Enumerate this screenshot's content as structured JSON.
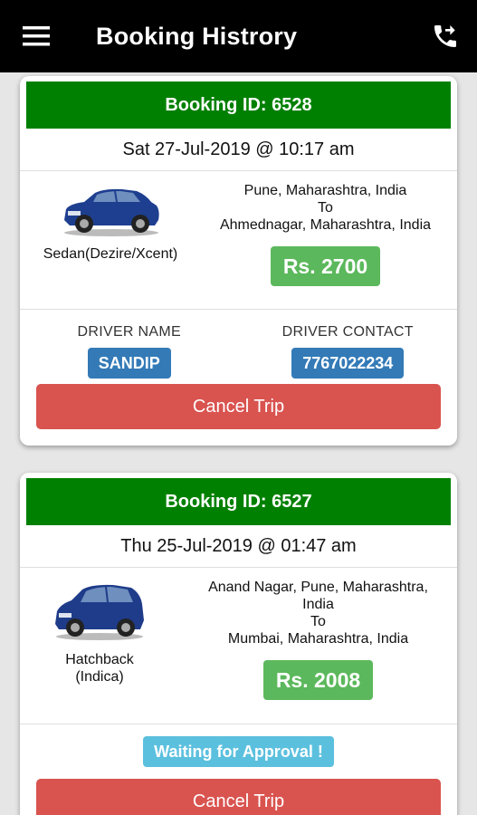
{
  "appbar": {
    "title": "Booking Histrory",
    "menu_icon": "hamburger-menu-icon",
    "call_icon": "phone-forward-icon"
  },
  "colors": {
    "header_green": "#008000",
    "fare_green": "#5cb85c",
    "driver_blue": "#337ab7",
    "cancel_red": "#d9534f",
    "status_cyan": "#5bc0de"
  },
  "bookings": [
    {
      "header": "Booking ID: 6528",
      "datetime": "Sat 27-Jul-2019 @  10:17 am",
      "car_label": "Sedan(Dezire/Xcent)",
      "car_icon": "sedan-car-image",
      "from": "Pune, Maharashtra, India",
      "to_word": "To",
      "to": "Ahmednagar, Maharashtra, India",
      "fare": "Rs. 2700",
      "driver_name_label": "DRIVER NAME",
      "driver_name": "SANDIP",
      "driver_contact_label": "DRIVER CONTACT",
      "driver_contact": "7767022234",
      "cancel_label": "Cancel Trip"
    },
    {
      "header": "Booking ID: 6527",
      "datetime": "Thu 25-Jul-2019 @  01:47 am",
      "car_label_line1": "Hatchback",
      "car_label_line2": "(Indica)",
      "car_icon": "hatchback-car-image",
      "from_line1": "Anand Nagar, Pune, Maharashtra,",
      "from_line2": "India",
      "to_word": "To",
      "to": "Mumbai, Maharashtra, India",
      "fare": "Rs. 2008",
      "status": "Waiting for Approval !",
      "cancel_label": "Cancel Trip"
    }
  ]
}
